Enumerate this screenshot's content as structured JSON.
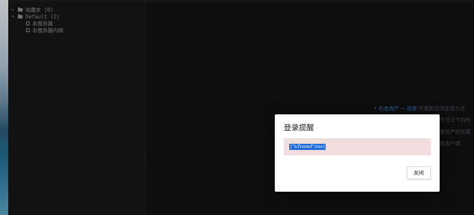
{
  "sidebar": {
    "tree": [
      {
        "label": "收藏夹 (0)",
        "expanded": false,
        "icon": "folder-icon",
        "level": 0
      },
      {
        "label": "Default (2)",
        "expanded": true,
        "icon": "folder-icon",
        "level": 0
      },
      {
        "label": "本服务器",
        "icon": "server-icon",
        "level": 1
      },
      {
        "label": "本服务器内网",
        "icon": "server-icon",
        "level": 1
      }
    ]
  },
  "main": {
    "hints": [
      {
        "bullet": "•",
        "accent": "右击资产 → 连接",
        "text": "  可重新选择连接方式"
      },
      {
        "text": "件节点下的所"
      },
      {
        "text": "置资产树加载"
      },
      {
        "text": "服务户端"
      }
    ]
  },
  "dialog": {
    "title": "登录提醒",
    "message": "{\"isTrusted\":true}",
    "close_label": "关闭",
    "alert_color": "#f2dede",
    "selection_color": "#1f6ad6"
  }
}
